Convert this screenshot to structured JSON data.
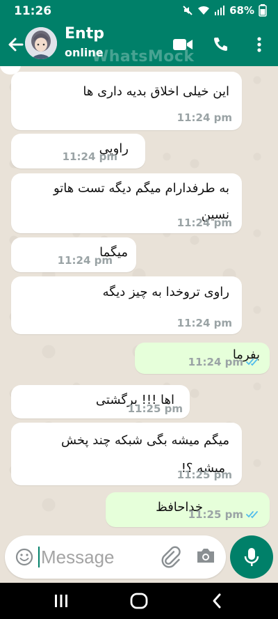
{
  "status_bar": {
    "time": "11:26",
    "battery": "68%"
  },
  "header": {
    "contact_name": "Entp",
    "contact_status": "online",
    "watermark": "WhatsMock"
  },
  "messages": [
    {
      "dir": "in",
      "lines": [
        "این خیلی اخلاق بدیه داری ها"
      ],
      "time": "11:24 pm"
    },
    {
      "dir": "in",
      "lines": [
        "راویی"
      ],
      "time": "11:24 pm"
    },
    {
      "dir": "in",
      "lines": [
        "به طرفدارام میگم دیگه تست هاتو",
        "نسین"
      ],
      "time": "11:24 pm"
    },
    {
      "dir": "in",
      "lines": [
        "میگما"
      ],
      "time": "11:24 pm"
    },
    {
      "dir": "in",
      "lines": [
        "راوی تروخدا به چیز دیگه"
      ],
      "time": "11:24 pm"
    },
    {
      "dir": "out",
      "lines": [
        "بفرما"
      ],
      "time": "11:24 pm"
    },
    {
      "dir": "in",
      "lines": [
        "اها !!! برگشتی"
      ],
      "time": "11:25 pm"
    },
    {
      "dir": "in",
      "lines": [
        "میگم میشه بگی شبکه چند پخش",
        "میشه ؟!"
      ],
      "time": "11:25 pm"
    },
    {
      "dir": "out",
      "lines": [
        "خداحافظ"
      ],
      "time": "11:25 pm"
    }
  ],
  "input": {
    "placeholder": "Message"
  },
  "colors": {
    "brand": "#008069",
    "outgoing": "#e6ffda",
    "incoming": "#ffffff",
    "tick_blue": "#53bdeb"
  },
  "icons": [
    "back-arrow-icon",
    "video-call-icon",
    "voice-call-icon",
    "more-options-icon",
    "emoji-icon",
    "attach-icon",
    "camera-icon",
    "mic-icon",
    "recent-apps-icon",
    "home-icon",
    "back-nav-icon"
  ]
}
